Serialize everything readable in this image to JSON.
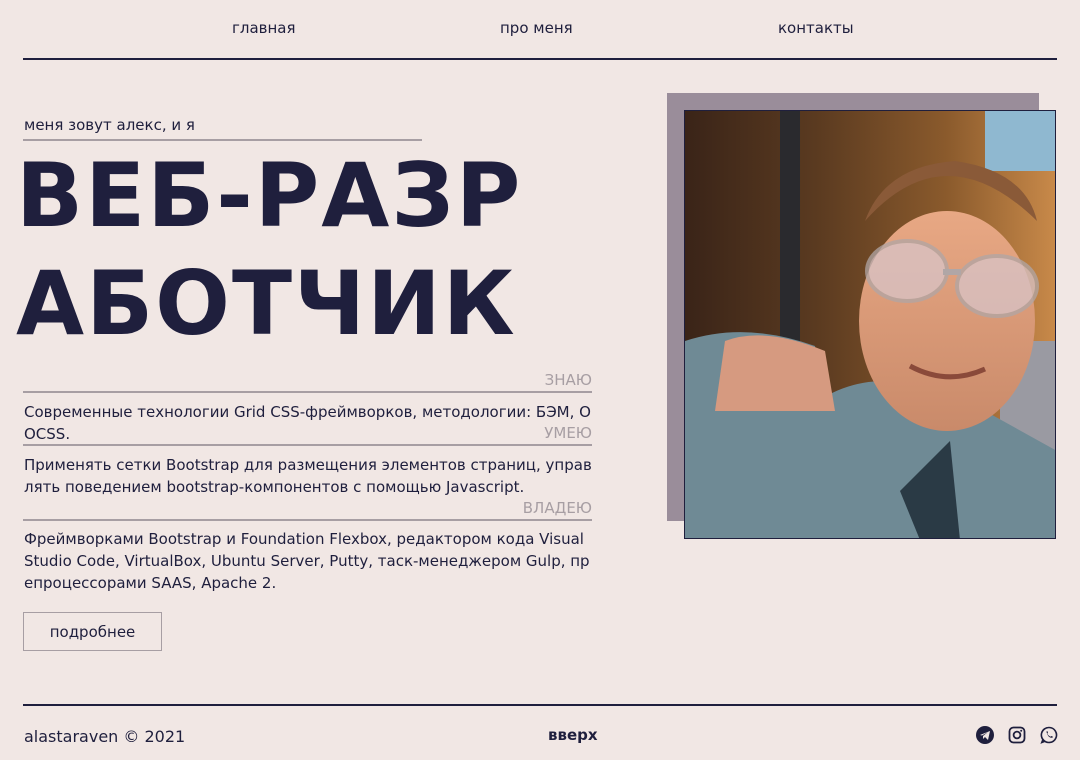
{
  "nav": {
    "home": "главная",
    "about": "про меня",
    "contacts": "контакты"
  },
  "hero": {
    "intro": "меня зовут алекс, и я",
    "title_line1": "ВЕБ-РАЗР",
    "title_line2": "АБОТЧИК"
  },
  "skills": [
    {
      "heading": "ЗНАЮ",
      "text": "Современные технологии Grid CSS-фреймворков, методологии: БЭМ, OOCSS."
    },
    {
      "heading": "УМЕЮ",
      "text": "Применять сетки Bootstrap для размещения элементов страниц, управлять поведением bootstrap-компонентов с помощью Javascript."
    },
    {
      "heading": "ВЛАДЕЮ",
      "text": "Фреймворками Bootstrap и Foundation Flexbox, редактором кода Visual Studio Code, VirtualBox, Ubuntu Server, Putty, таск-менеджером Gulp, препроцессорами SAAS, Apache 2."
    }
  ],
  "more_button": "подробнее",
  "footer": {
    "copyright": "alastaraven © 2021",
    "up": "вверх",
    "icons": [
      "telegram-icon",
      "instagram-icon",
      "whatsapp-icon"
    ]
  },
  "colors": {
    "background": "#f1e7e4",
    "ink": "#1f1f3d",
    "muted": "#a79ea3",
    "photo_backdrop": "#9a8d9a"
  }
}
